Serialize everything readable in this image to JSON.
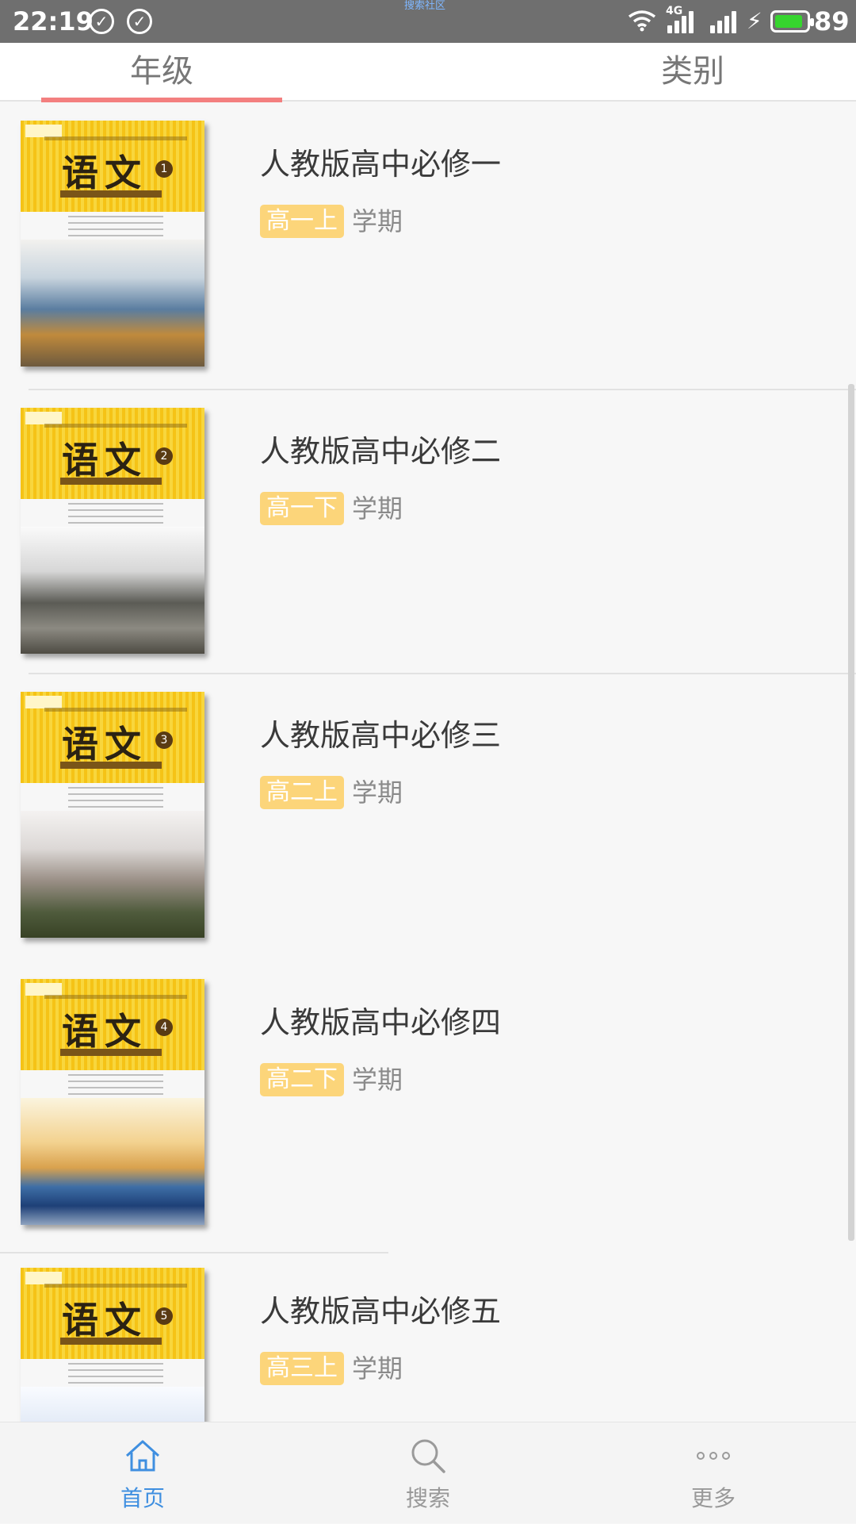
{
  "status_bar": {
    "time": "22:19",
    "center_note": "搜索社区",
    "network": "4G",
    "battery_percent": "89",
    "battery_level": 0.89,
    "battery_color": "#36d52e"
  },
  "tabs": [
    {
      "label": "年级",
      "selected": true
    },
    {
      "label": "类别",
      "selected": false
    }
  ],
  "accent_color": "#f37f7f",
  "badge_color": "#fcd57a",
  "books": [
    {
      "title": "人教版高中必修一",
      "grade": "高一上",
      "term": "学期",
      "cover_title": "语文",
      "cover_volume": "1"
    },
    {
      "title": "人教版高中必修二",
      "grade": "高一下",
      "term": "学期",
      "cover_title": "语文",
      "cover_volume": "2"
    },
    {
      "title": "人教版高中必修三",
      "grade": "高二上",
      "term": "学期",
      "cover_title": "语文",
      "cover_volume": "3"
    },
    {
      "title": "人教版高中必修四",
      "grade": "高二下",
      "term": "学期",
      "cover_title": "语文",
      "cover_volume": "4"
    },
    {
      "title": "人教版高中必修五",
      "grade": "高三上",
      "term": "学期",
      "cover_title": "语文",
      "cover_volume": "5"
    }
  ],
  "bottom_nav": [
    {
      "label": "首页",
      "icon": "home-icon",
      "active": true,
      "color": "#3f8fe0"
    },
    {
      "label": "搜索",
      "icon": "search-icon",
      "active": false
    },
    {
      "label": "更多",
      "icon": "more-icon",
      "active": false
    }
  ]
}
